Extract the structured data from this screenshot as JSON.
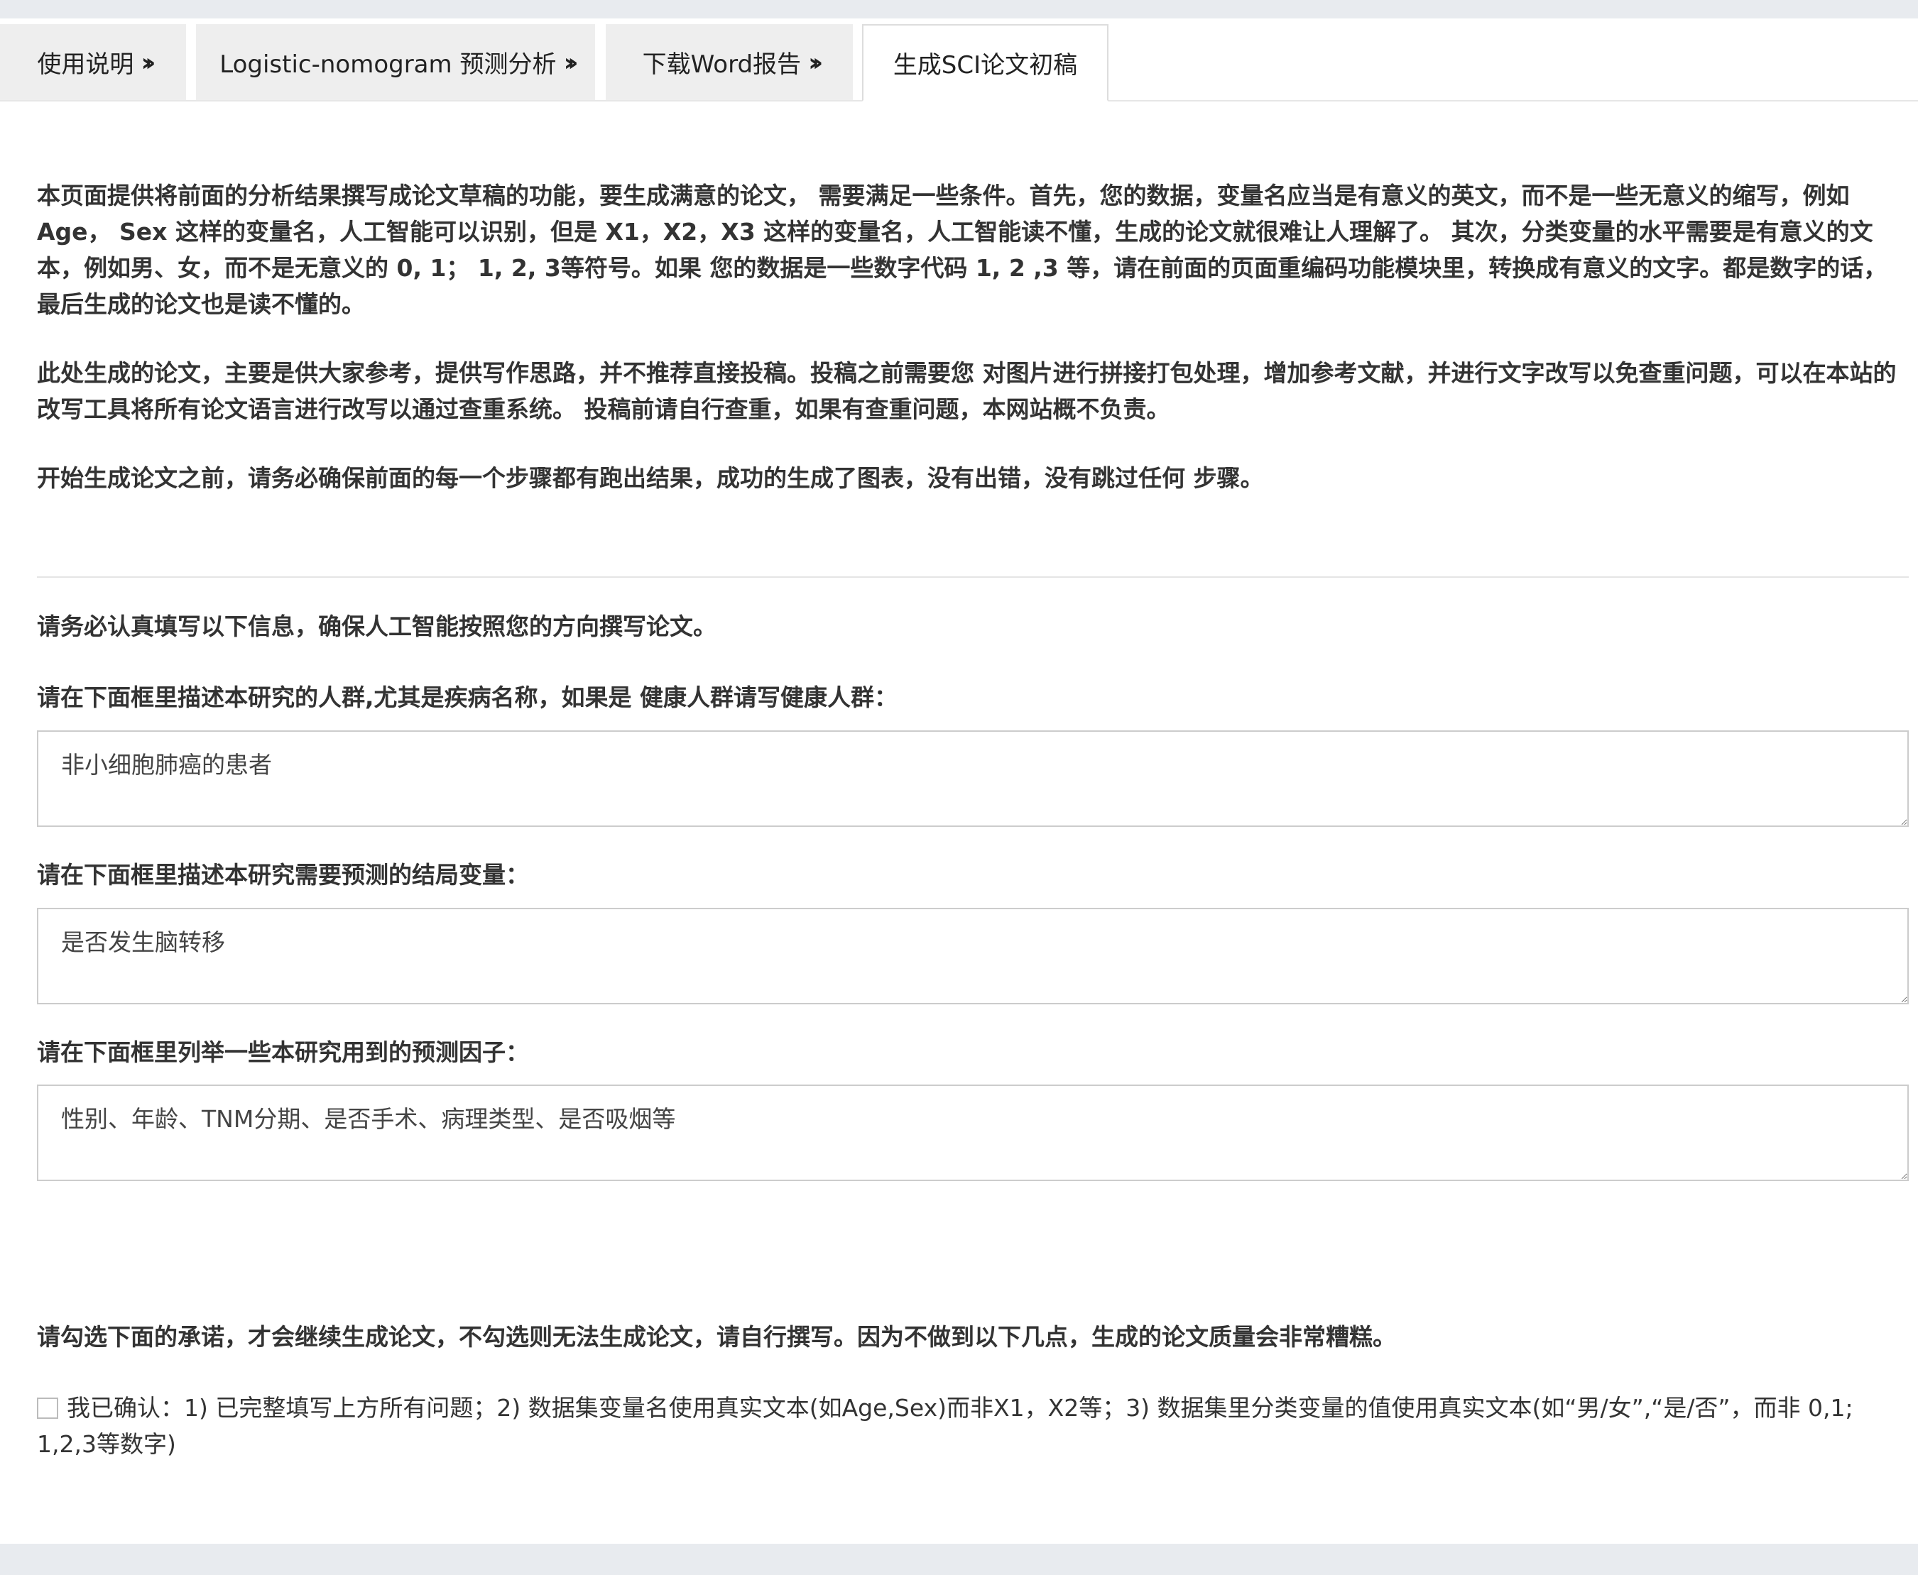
{
  "tabs": [
    {
      "label": "使用说明",
      "active": false
    },
    {
      "label": "Logistic-nomogram 预测分析",
      "active": false
    },
    {
      "label": "下载Word报告",
      "active": false
    },
    {
      "label": "生成SCI论文初稿",
      "active": true
    }
  ],
  "intro": {
    "p1": "本页面提供将前面的分析结果撰写成论文草稿的功能，要生成满意的论文， 需要满足一些条件。首先，您的数据，变量名应当是有意义的英文，而不是一些无意义的缩写，例如Age， Sex 这样的变量名，人工智能可以识别，但是 X1，X2，X3 这样的变量名，人工智能读不懂，生成的论文就很难让人理解了。 其次，分类变量的水平需要是有意义的文本，例如男、女，而不是无意义的 0, 1； 1, 2, 3等符号。如果 您的数据是一些数字代码 1, 2 ,3 等，请在前面的页面重编码功能模块里，转换成有意义的文字。都是数字的话，最后生成的论文也是读不懂的。",
    "p2": "此处生成的论文，主要是供大家参考，提供写作思路，并不推荐直接投稿。投稿之前需要您 对图片进行拼接打包处理，增加参考文献，并进行文字改写以免查重问题，可以在本站的改写工具将所有论文语言进行改写以通过查重系统。 投稿前请自行查重，如果有查重问题，本网站概不负责。",
    "p3": "开始生成论文之前，请务必确保前面的每一个步骤都有跑出结果，成功的生成了图表，没有出错，没有跳过任何 步骤。"
  },
  "form": {
    "heading": "请务必认真填写以下信息，确保人工智能按照您的方向撰写论文。",
    "population_label": "请在下面框里描述本研究的人群,尤其是疾病名称，如果是 健康人群请写健康人群：",
    "population_value": "非小细胞肺癌的患者",
    "outcome_label": "请在下面框里描述本研究需要预测的结局变量：",
    "outcome_value": "是否发生脑转移",
    "predictors_label": "请在下面框里列举一些本研究用到的预测因子：",
    "predictors_value": "性别、年龄、TNM分期、是否手术、病理类型、是否吸烟等"
  },
  "commitment": {
    "heading": "请勾选下面的承诺，才会继续生成论文，不勾选则无法生成论文，请自行撰写。因为不做到以下几点，生成的论文质量会非常糟糕。",
    "checkbox_label": "我已确认：1) 已完整填写上方所有问题；2) 数据集变量名使用真实文本(如Age,Sex)而非X1，X2等；3) 数据集里分类变量的值使用真实文本(如“男/女”,“是/否”，而非 0,1; 1,2,3等数字)",
    "checked": false
  }
}
